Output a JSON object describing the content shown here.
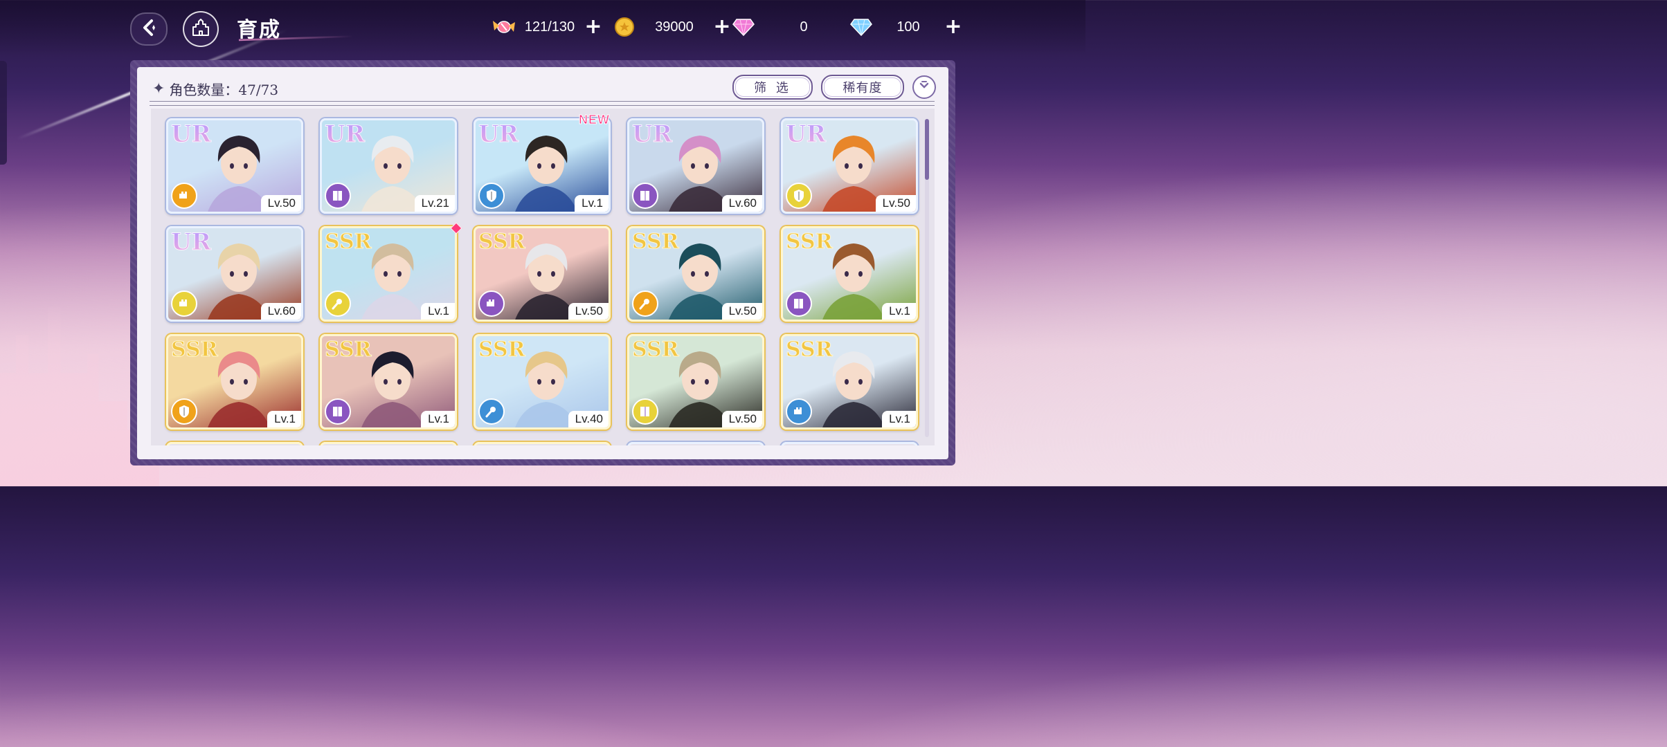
{
  "header": {
    "title": "育成",
    "back_icon": "back-arrow-icon",
    "home_icon": "castle-home-icon"
  },
  "resources": [
    {
      "name": "stamina",
      "icon": "candy-icon",
      "value": "121/130"
    },
    {
      "name": "gold",
      "icon": "coin-icon",
      "value": "39000"
    },
    {
      "name": "paid-gem",
      "icon": "pink-diamond-icon",
      "value": "0"
    },
    {
      "name": "free-gem",
      "icon": "blue-diamond-icon",
      "value": "100"
    }
  ],
  "panel": {
    "count_label": "角色数量：47/73",
    "filter_label": "筛 选",
    "sort_label": "稀有度"
  },
  "colors": {
    "ur_border": "#aab8e0",
    "ssr_border": "#e9c25a",
    "new_badge": "#ff2e7c",
    "panel_frame": "#5b4482"
  },
  "cards": [
    {
      "rarity": "UR",
      "level": "Lv.50",
      "type_color": "#f0a21a",
      "type_icon": "fist-icon",
      "art": [
        "#cfe3f6",
        "#b7a7dd"
      ],
      "hair": "#2a2230",
      "new": false
    },
    {
      "rarity": "UR",
      "level": "Lv.21",
      "type_color": "#8a55c0",
      "type_icon": "book-icon",
      "art": [
        "#bfe1f2",
        "#f0e6d8"
      ],
      "hair": "#e8ecf0",
      "new": false
    },
    {
      "rarity": "UR",
      "level": "Lv.1",
      "type_color": "#3d8fd6",
      "type_icon": "shield-icon",
      "art": [
        "#c6e6f7",
        "#2b4e9a"
      ],
      "hair": "#2c2623",
      "new": true
    },
    {
      "rarity": "UR",
      "level": "Lv.60",
      "type_color": "#8a55c0",
      "type_icon": "book-icon",
      "art": [
        "#c9d9ec",
        "#3a2b3a"
      ],
      "hair": "#d48fc8",
      "new": false
    },
    {
      "rarity": "UR",
      "level": "Lv.50",
      "type_color": "#e8d23a",
      "type_icon": "shield-icon",
      "art": [
        "#d8e7f2",
        "#c54a2a"
      ],
      "hair": "#e8862a",
      "new": false
    },
    {
      "rarity": "UR",
      "level": "Lv.60",
      "type_color": "#e8d23a",
      "type_icon": "fist-icon",
      "art": [
        "#d6e4f0",
        "#9a3b22"
      ],
      "hair": "#e8d3a8",
      "new": false
    },
    {
      "rarity": "SSR",
      "level": "Lv.1",
      "type_color": "#e8d23a",
      "type_icon": "wand-icon",
      "art": [
        "#bfe2f0",
        "#dcd6e8"
      ],
      "hair": "#d2bd9e",
      "new": false
    },
    {
      "rarity": "SSR",
      "level": "Lv.50",
      "type_color": "#8a55c0",
      "type_icon": "fist-icon",
      "art": [
        "#f2c8c2",
        "#2a2430"
      ],
      "hair": "#e7e7ea",
      "new": false
    },
    {
      "rarity": "SSR",
      "level": "Lv.50",
      "type_color": "#f0a21a",
      "type_icon": "wand-icon",
      "art": [
        "#cfe1ee",
        "#1f5a6a"
      ],
      "hair": "#1b4d5a",
      "new": false
    },
    {
      "rarity": "SSR",
      "level": "Lv.1",
      "type_color": "#8a55c0",
      "type_icon": "book-icon",
      "art": [
        "#dbe8f2",
        "#7aa23a"
      ],
      "hair": "#9a5a2e",
      "new": false
    },
    {
      "rarity": "SSR",
      "level": "Lv.1",
      "type_color": "#f0a21a",
      "type_icon": "shield-icon",
      "art": [
        "#f4d9a0",
        "#9a2e2e"
      ],
      "hair": "#ea8a8a",
      "new": false
    },
    {
      "rarity": "SSR",
      "level": "Lv.1",
      "type_color": "#8a55c0",
      "type_icon": "book-icon",
      "art": [
        "#e8c2b8",
        "#8f5a7a"
      ],
      "hair": "#1c1c2e",
      "new": false
    },
    {
      "rarity": "SSR",
      "level": "Lv.40",
      "type_color": "#3d8fd6",
      "type_icon": "wand-icon",
      "art": [
        "#cfe6f6",
        "#aac6ea"
      ],
      "hair": "#e6c78a",
      "new": false
    },
    {
      "rarity": "SSR",
      "level": "Lv.50",
      "type_color": "#e8d23a",
      "type_icon": "book-icon",
      "art": [
        "#d5e7d6",
        "#2a2a24"
      ],
      "hair": "#b9aa8a",
      "new": false
    },
    {
      "rarity": "SSR",
      "level": "Lv.1",
      "type_color": "#3d8fd6",
      "type_icon": "fist-icon",
      "art": [
        "#dbe7f2",
        "#2b2a38"
      ],
      "hair": "#e8eaee",
      "new": false
    }
  ]
}
